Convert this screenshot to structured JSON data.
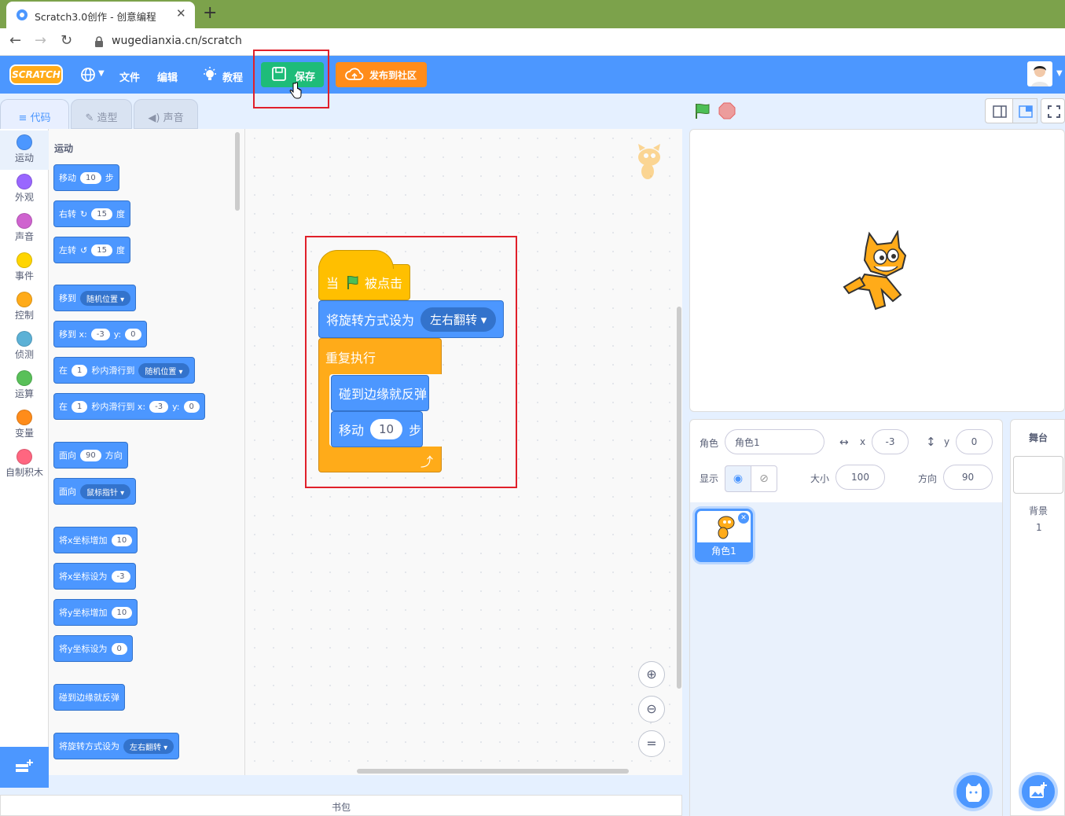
{
  "browser": {
    "tab_title": "Scratch3.0创作 - 创意编程",
    "url": "wugedianxia.cn/scratch"
  },
  "menu": {
    "logo": "SCRATCH",
    "file": "文件",
    "edit": "编辑",
    "tutorial": "教程",
    "save": "保存",
    "publish": "发布到社区"
  },
  "editor_tabs": [
    "代码",
    "造型",
    "声音"
  ],
  "categories": [
    {
      "label": "运动",
      "color": "#4c97ff"
    },
    {
      "label": "外观",
      "color": "#9966ff"
    },
    {
      "label": "声音",
      "color": "#cf63cf"
    },
    {
      "label": "事件",
      "color": "#ffd500"
    },
    {
      "label": "控制",
      "color": "#ffab19"
    },
    {
      "label": "侦测",
      "color": "#5cb1d6"
    },
    {
      "label": "运算",
      "color": "#59c059"
    },
    {
      "label": "变量",
      "color": "#ff8c1a"
    },
    {
      "label": "自制积木",
      "color": "#ff6680"
    }
  ],
  "palette": {
    "heading": "运动",
    "move": {
      "a": "移动",
      "v": "10",
      "b": "步"
    },
    "turn_right": {
      "a": "右转",
      "v": "15",
      "b": "度"
    },
    "turn_left": {
      "a": "左转",
      "v": "15",
      "b": "度"
    },
    "goto": {
      "a": "移到",
      "dd": "随机位置"
    },
    "goto_xy": {
      "a": "移到 x:",
      "x": "-3",
      "b": "y:",
      "y": "0"
    },
    "glide": {
      "a": "在",
      "v": "1",
      "b": "秒内滑行到",
      "dd": "随机位置"
    },
    "glide_xy": {
      "a": "在",
      "v": "1",
      "b": "秒内滑行到 x:",
      "x": "-3",
      "c": "y:",
      "y": "0"
    },
    "point_dir": {
      "a": "面向",
      "v": "90",
      "b": "方向"
    },
    "point_towards": {
      "a": "面向",
      "dd": "鼠标指针"
    },
    "change_x": {
      "a": "将x坐标增加",
      "v": "10"
    },
    "set_x": {
      "a": "将x坐标设为",
      "v": "-3"
    },
    "change_y": {
      "a": "将y坐标增加",
      "v": "10"
    },
    "set_y": {
      "a": "将y坐标设为",
      "v": "0"
    },
    "bounce": {
      "a": "碰到边缘就反弹"
    },
    "rot_style": {
      "a": "将旋转方式设为",
      "dd": "左右翻转"
    }
  },
  "script": {
    "when_flag": {
      "a": "当",
      "b": "被点击"
    },
    "rot_style": {
      "a": "将旋转方式设为",
      "dd": "左右翻转"
    },
    "forever": "重复执行",
    "bounce": "碰到边缘就反弹",
    "move": {
      "a": "移动",
      "v": "10",
      "b": "步"
    }
  },
  "backpack": "书包",
  "sprite_info": {
    "sprite_label": "角色",
    "sprite_name": "角色1",
    "x_label": "x",
    "x": "-3",
    "y_label": "y",
    "y": "0",
    "show_label": "显示",
    "size_label": "大小",
    "size": "100",
    "direction_label": "方向",
    "direction": "90"
  },
  "sprite_tile": "角色1",
  "stage_pane": {
    "title": "舞台",
    "backdrop_label": "背景",
    "backdrop_count": "1"
  }
}
